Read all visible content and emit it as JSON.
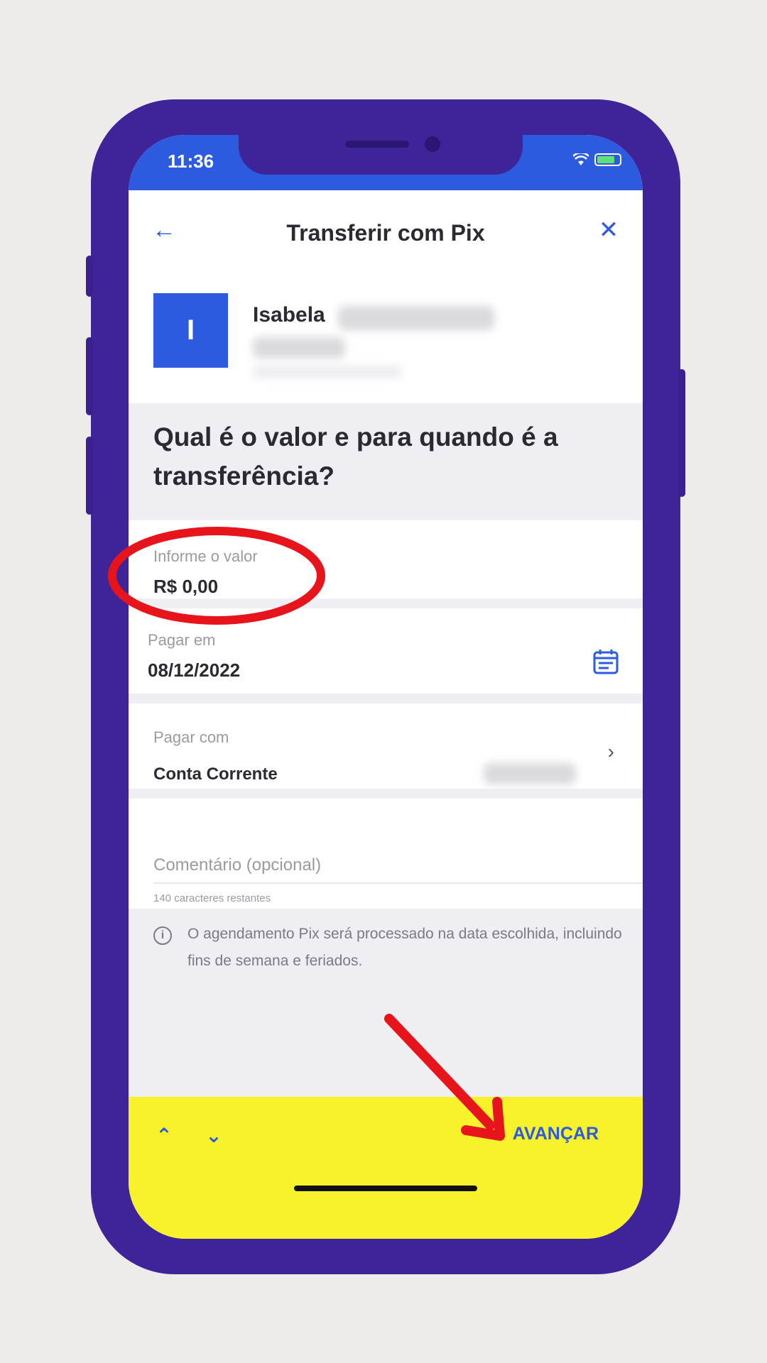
{
  "status_bar": {
    "time": "11:36"
  },
  "header": {
    "title": "Transferir com Pix",
    "back_icon": "arrow-left-icon",
    "close_icon": "close-icon"
  },
  "contact": {
    "initial": "I",
    "first_name": "Isabela"
  },
  "question": "Qual é o valor e para quando é a transferência?",
  "amount": {
    "label": "Informe o valor",
    "value": "R$ 0,00"
  },
  "date": {
    "label": "Pagar em",
    "value": "08/12/2022",
    "icon": "calendar-icon"
  },
  "account": {
    "label": "Pagar com",
    "value": "Conta Corrente",
    "icon": "chevron-right-icon"
  },
  "comment": {
    "placeholder": "Comentário (opcional)",
    "helper": "140 caracteres restantes"
  },
  "info": {
    "icon": "info-icon",
    "text": "O agendamento Pix será processado na data escolhida, incluindo fins de semana e feriados."
  },
  "bottom_bar": {
    "advance_label": "AVANÇAR",
    "prev_icon": "chevron-up-icon",
    "next_icon": "chevron-down-icon"
  },
  "colors": {
    "brand_blue": "#2c5be0",
    "phone_frame": "#3f2398",
    "bar_yellow": "#f8f22a",
    "annotation_red": "#e8141c"
  }
}
